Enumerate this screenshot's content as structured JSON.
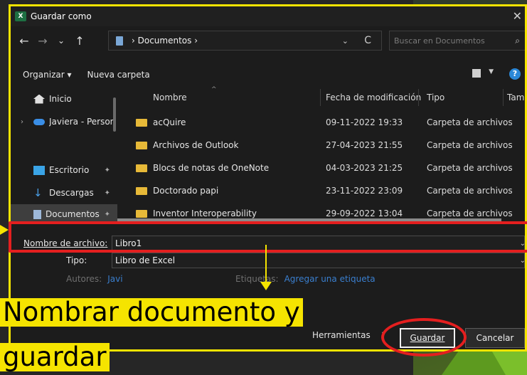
{
  "window": {
    "title": "Guardar como",
    "app_icon": "X"
  },
  "navigation": {
    "back_icon": "←",
    "forward_icon": "→",
    "recent_icon": "⌄",
    "up_icon": "↑",
    "address_path": "› Documentos ›",
    "address_dropdown_icon": "⌄",
    "refresh_icon": "C",
    "search_placeholder": "Buscar en Documentos",
    "search_icon": "⌕"
  },
  "toolbar": {
    "organizar_label": "Organizar ▾",
    "nueva_carpeta_label": "Nueva carpeta",
    "help_label": "?"
  },
  "sidebar": {
    "items": [
      {
        "label": "Inicio",
        "icon": "home-icon"
      },
      {
        "label": "Javiera - Persona",
        "icon": "onedrive-cloud-icon"
      },
      {
        "label": "Escritorio",
        "icon": "desktop-icon"
      },
      {
        "label": "Descargas",
        "icon": "download-icon"
      },
      {
        "label": "Documentos",
        "icon": "documents-icon",
        "selected": true
      }
    ]
  },
  "filelist": {
    "columns": [
      "Nombre",
      "Fecha de modificación",
      "Tipo",
      "Tamañ"
    ],
    "rows": [
      {
        "name": "acQuire",
        "date": "09-11-2022 19:33",
        "type": "Carpeta de archivos"
      },
      {
        "name": "Archivos de Outlook",
        "date": "27-04-2023 21:55",
        "type": "Carpeta de archivos"
      },
      {
        "name": "Blocs de notas de OneNote",
        "date": "04-03-2023 21:25",
        "type": "Carpeta de archivos"
      },
      {
        "name": "Doctorado papi",
        "date": "23-11-2022 23:09",
        "type": "Carpeta de archivos"
      },
      {
        "name": "Inventor Interoperability",
        "date": "29-09-2022 13:04",
        "type": "Carpeta de archivos"
      }
    ]
  },
  "form": {
    "filename_label": "Nombre de archivo:",
    "filename_value": "Libro1",
    "type_label": "Tipo:",
    "type_value": "Libro de Excel",
    "authors_label": "Autores:",
    "authors_value": "Javi",
    "tags_label": "Etiquetas:",
    "tags_value": "Agregar una etiqueta"
  },
  "footer": {
    "tools_label": "Herramientas",
    "save_label": "Guardar",
    "cancel_label": "Cancelar"
  },
  "annotation": {
    "line1": "Nombrar documento y",
    "line2": "guardar",
    "highlight_color": "#f5e400",
    "marker_color": "#e41f1f"
  }
}
